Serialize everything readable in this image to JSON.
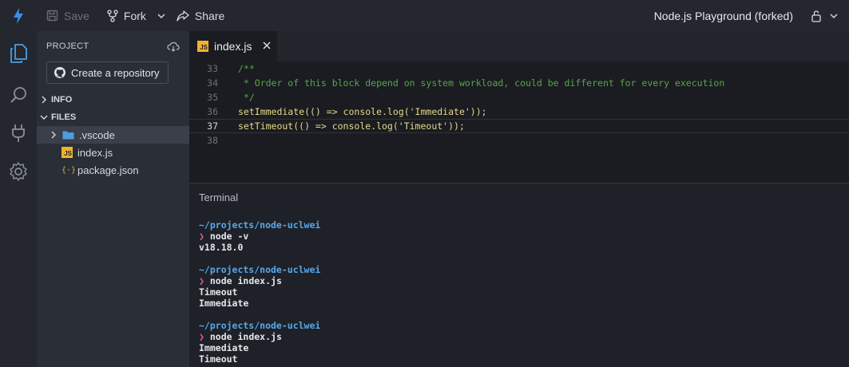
{
  "topbar": {
    "save_label": "Save",
    "fork_label": "Fork",
    "share_label": "Share",
    "project_title": "Node.js Playground (forked)"
  },
  "sidebar": {
    "header": "PROJECT",
    "create_repo_label": "Create a repository",
    "sections": {
      "info": "INFO",
      "files": "FILES"
    },
    "files": [
      ".vscode",
      "index.js",
      "package.json"
    ]
  },
  "editor": {
    "tab_label": "index.js",
    "tab_icon": "JS",
    "lines": [
      {
        "n": "33",
        "text": "/**"
      },
      {
        "n": "34",
        "text": " * Order of this block depend on system workload, could be different for every execution"
      },
      {
        "n": "35",
        "text": " */"
      },
      {
        "n": "36",
        "text": "setImmediate(() => console.log('Immediate'));"
      },
      {
        "n": "37",
        "text": "setTimeout(() => console.log('Timeout'));"
      },
      {
        "n": "38",
        "text": ""
      }
    ]
  },
  "terminal": {
    "title": "Terminal",
    "blocks": [
      {
        "path": "~/projects/node-uclwei",
        "prompt": "❯",
        "cmd": "node -v",
        "output": [
          "v18.18.0"
        ]
      },
      {
        "path": "~/projects/node-uclwei",
        "prompt": "❯",
        "cmd": "node index.js",
        "output": [
          "Timeout",
          "Immediate"
        ]
      },
      {
        "path": "~/projects/node-uclwei",
        "prompt": "❯",
        "cmd": "node index.js",
        "output": [
          "Immediate",
          "Timeout"
        ]
      }
    ]
  },
  "colors": {
    "accent": "#3b8eea",
    "js_badge": "#f0b22e",
    "folder": "#4d9de0"
  }
}
